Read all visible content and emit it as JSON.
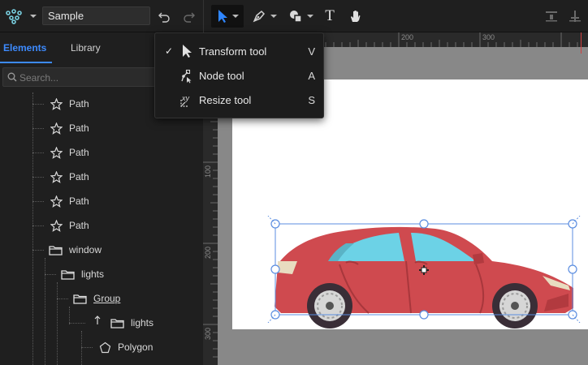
{
  "toolbar": {
    "document_name": "Sample",
    "tools": [
      "logo-icon",
      "undo-icon",
      "redo-icon",
      "pointer-icon",
      "pen-icon",
      "shapes-icon",
      "text-icon",
      "hand-icon",
      "align-bottom-icon",
      "align-center-icon"
    ],
    "text_tool_glyph": "T"
  },
  "sidebar": {
    "tabs": [
      {
        "label": "Elements",
        "active": true
      },
      {
        "label": "Library",
        "active": false
      }
    ],
    "search": {
      "placeholder": "Search..."
    },
    "tree": [
      {
        "label": "Path",
        "icon": "path-icon"
      },
      {
        "label": "Path",
        "icon": "path-icon"
      },
      {
        "label": "Path",
        "icon": "path-icon"
      },
      {
        "label": "Path",
        "icon": "path-icon"
      },
      {
        "label": "Path",
        "icon": "path-icon"
      },
      {
        "label": "Path",
        "icon": "path-icon"
      },
      {
        "label": "window",
        "icon": "folder-icon"
      },
      {
        "label": "lights",
        "icon": "folder-icon"
      },
      {
        "label": "Group",
        "icon": "folder-icon"
      },
      {
        "label": "lights",
        "icon": "folder-icon"
      },
      {
        "label": "Polygon",
        "icon": "polygon-icon"
      }
    ]
  },
  "rulers": {
    "top_labels": [
      "200",
      "300"
    ],
    "left_labels": [
      "100",
      "200",
      "300"
    ]
  },
  "tool_menu": {
    "items": [
      {
        "label": "Transform tool",
        "shortcut": "V",
        "checked": true,
        "icon": "transform-arrow-icon"
      },
      {
        "label": "Node tool",
        "shortcut": "A",
        "checked": false,
        "icon": "node-icon"
      },
      {
        "label": "Resize tool",
        "shortcut": "S",
        "checked": false,
        "icon": "resize-icon"
      }
    ],
    "check_glyph": "✓"
  },
  "colors": {
    "accent": "#3d8bff",
    "car_body": "#cf4a4f",
    "car_window": "#6cd2e6",
    "canvas_bg": "#888888",
    "selection": "#5b8de0"
  }
}
